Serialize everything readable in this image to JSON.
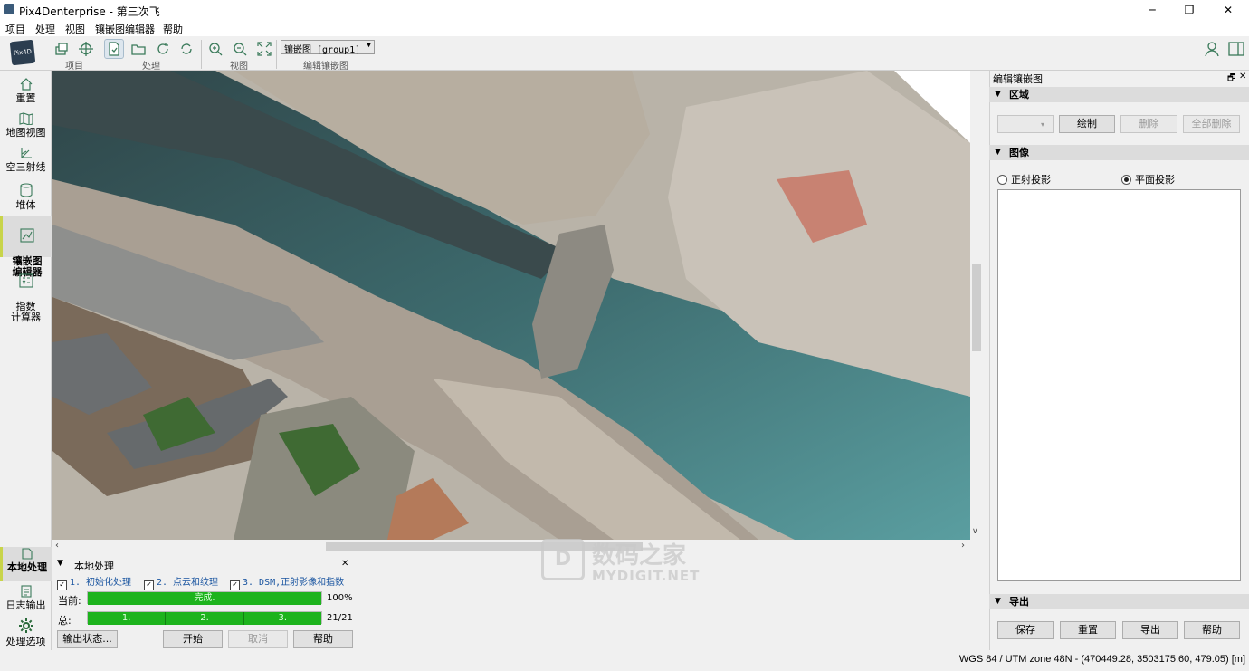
{
  "titlebar": {
    "title": "Pix4Denterprise - 第三次飞",
    "minimize": "─",
    "maximize": "❐",
    "close": "✕"
  },
  "menu": [
    "项目",
    "处理",
    "视图",
    "镶嵌图编辑器",
    "帮助"
  ],
  "logo": "Pix4D",
  "toolbar": {
    "groups": [
      "项目",
      "处理",
      "视图",
      "编辑镶嵌图"
    ],
    "mosaic_select": "镶嵌图 [group1]"
  },
  "leftnav": {
    "items": [
      "重置",
      "地图视图",
      "空三射线",
      "堆体",
      "镶嵌图\n编辑器",
      "指数\n计算器"
    ],
    "bottom_items": [
      "本地处理",
      "日志输出",
      "处理选项"
    ]
  },
  "right_panel": {
    "title": "编辑镶嵌图",
    "section_region": "区域",
    "draw": "绘制",
    "delete": "删除",
    "delete_all": "全部删除",
    "section_image": "图像",
    "radio_ortho": "正射投影",
    "radio_planar": "平面投影",
    "section_export": "导出",
    "buttons": [
      "保存",
      "重置",
      "导出",
      "帮助"
    ]
  },
  "processing": {
    "title": "本地处理",
    "steps": [
      "1. 初始化处理",
      "2. 点云和纹理",
      "3. DSM,正射影像和指数"
    ],
    "current_label": "当前:",
    "current_text": "完成.",
    "current_pct": "100%",
    "current_progress": 1.0,
    "total_label": "总:",
    "total_segments": [
      "1.",
      "2.",
      "3."
    ],
    "total_count": "21/21",
    "total_progress": 1.0,
    "buttons": {
      "output_status": "输出状态...",
      "start": "开始",
      "cancel": "取消",
      "help": "帮助"
    }
  },
  "status": {
    "coords": "WGS 84 / UTM zone 48N - (470449.28, 3503175.60, 479.05) [m]"
  },
  "watermark": {
    "brand": "数码之家",
    "url": "MYDIGIT.NET"
  },
  "colors": {
    "progress": "#1db31d",
    "water": "#3d7a7e",
    "active_nav": "#c8d44a"
  }
}
